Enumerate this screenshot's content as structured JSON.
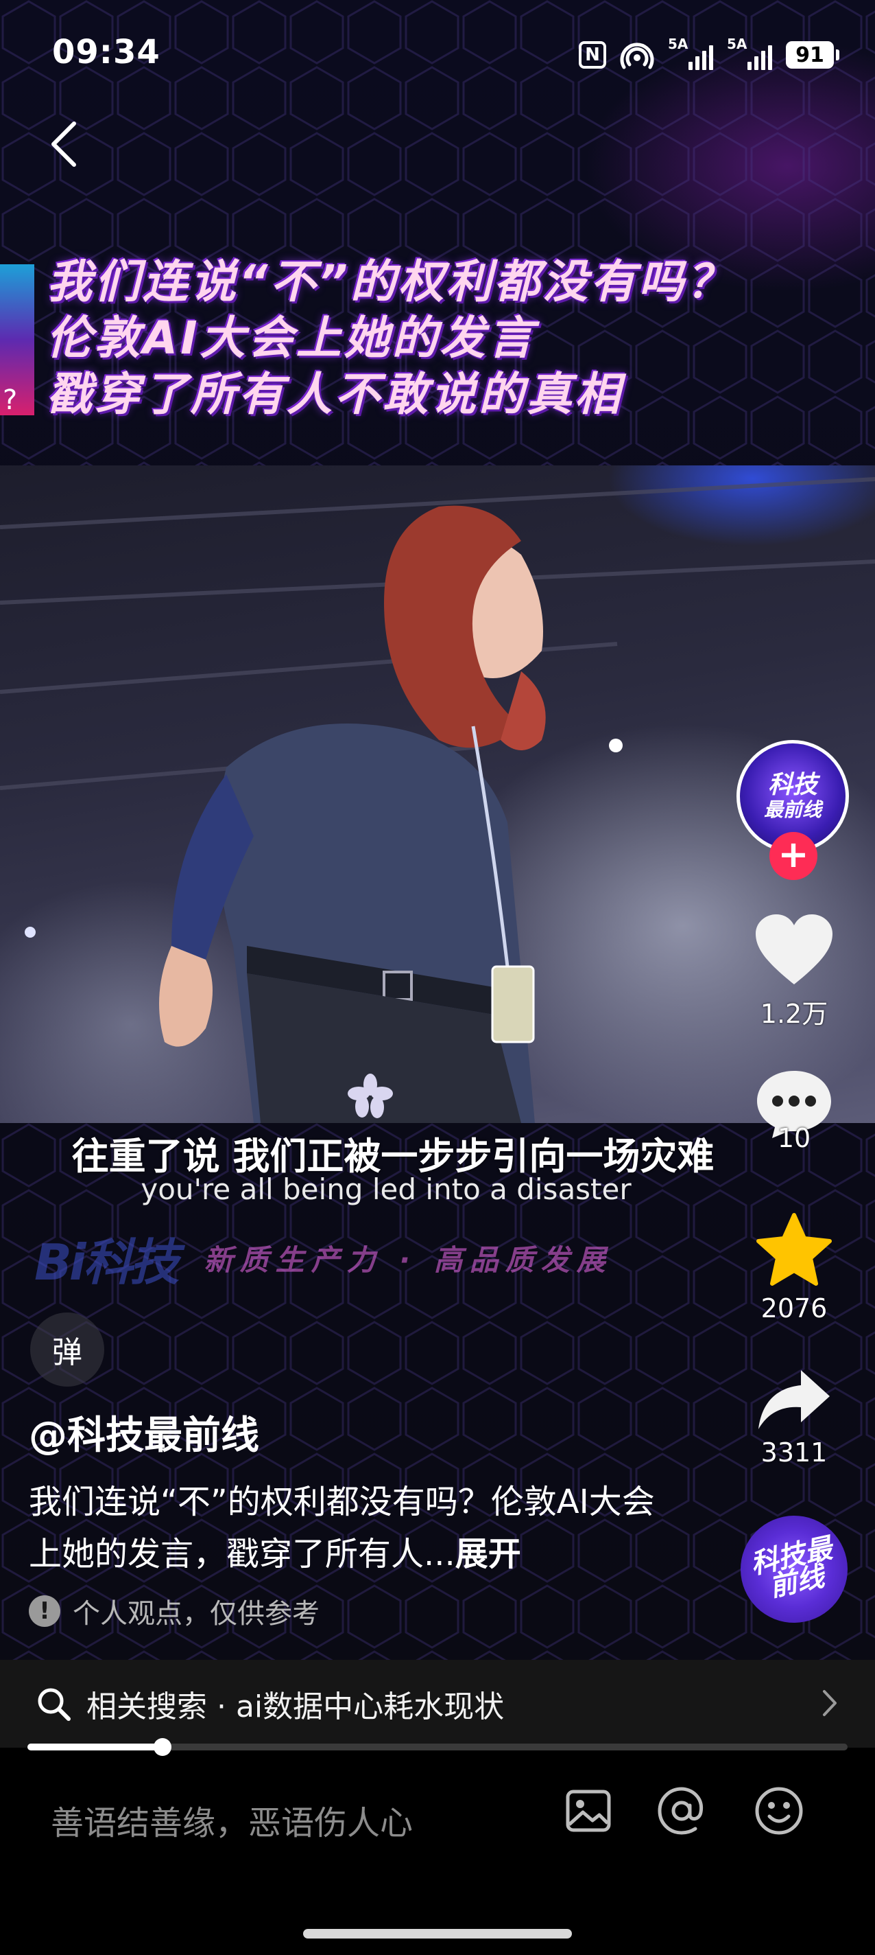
{
  "status_bar": {
    "time": "09:34",
    "signal_1_label": "5A",
    "signal_2_label": "5A",
    "battery": "91"
  },
  "video": {
    "title_lines": [
      "我们连说“不”的权利都没有吗？",
      "伦敦AI大会上她的发言",
      "戳穿了所有人不敢说的真相"
    ],
    "edge_text": "?",
    "subtitle_cn": "往重了说 我们正被一步步引向一场灾难",
    "subtitle_en": "you're all being led into a disaster",
    "watermark_logo": "Bi科技",
    "watermark_tagline": "新质生产力 · 高品质发展"
  },
  "rail": {
    "avatar_line1": "科技",
    "avatar_line2": "最前线",
    "follow": "+",
    "likes": "1.2万",
    "comments": "10",
    "favorites": "2076",
    "shares": "3311",
    "music_disc_text": "科技最前线"
  },
  "danmu_label": "弹",
  "author": "@科技最前线",
  "description": {
    "text": "我们连说“不”的权利都没有吗？伦敦AI大会上她的发言，戳穿了所有人...",
    "more": "展开"
  },
  "notice": {
    "icon": "!",
    "text": "个人观点，仅供参考"
  },
  "related_search": {
    "label": "相关搜索 · ai数据中心耗水现状"
  },
  "progress": {
    "fraction": 0.165
  },
  "comment_bar": {
    "placeholder": "善语结善缘，恶语伤人心"
  },
  "colors": {
    "accent_red": "#fe2c55",
    "favorite_yellow": "#ffc400",
    "title_glow": "#7b25d4"
  }
}
